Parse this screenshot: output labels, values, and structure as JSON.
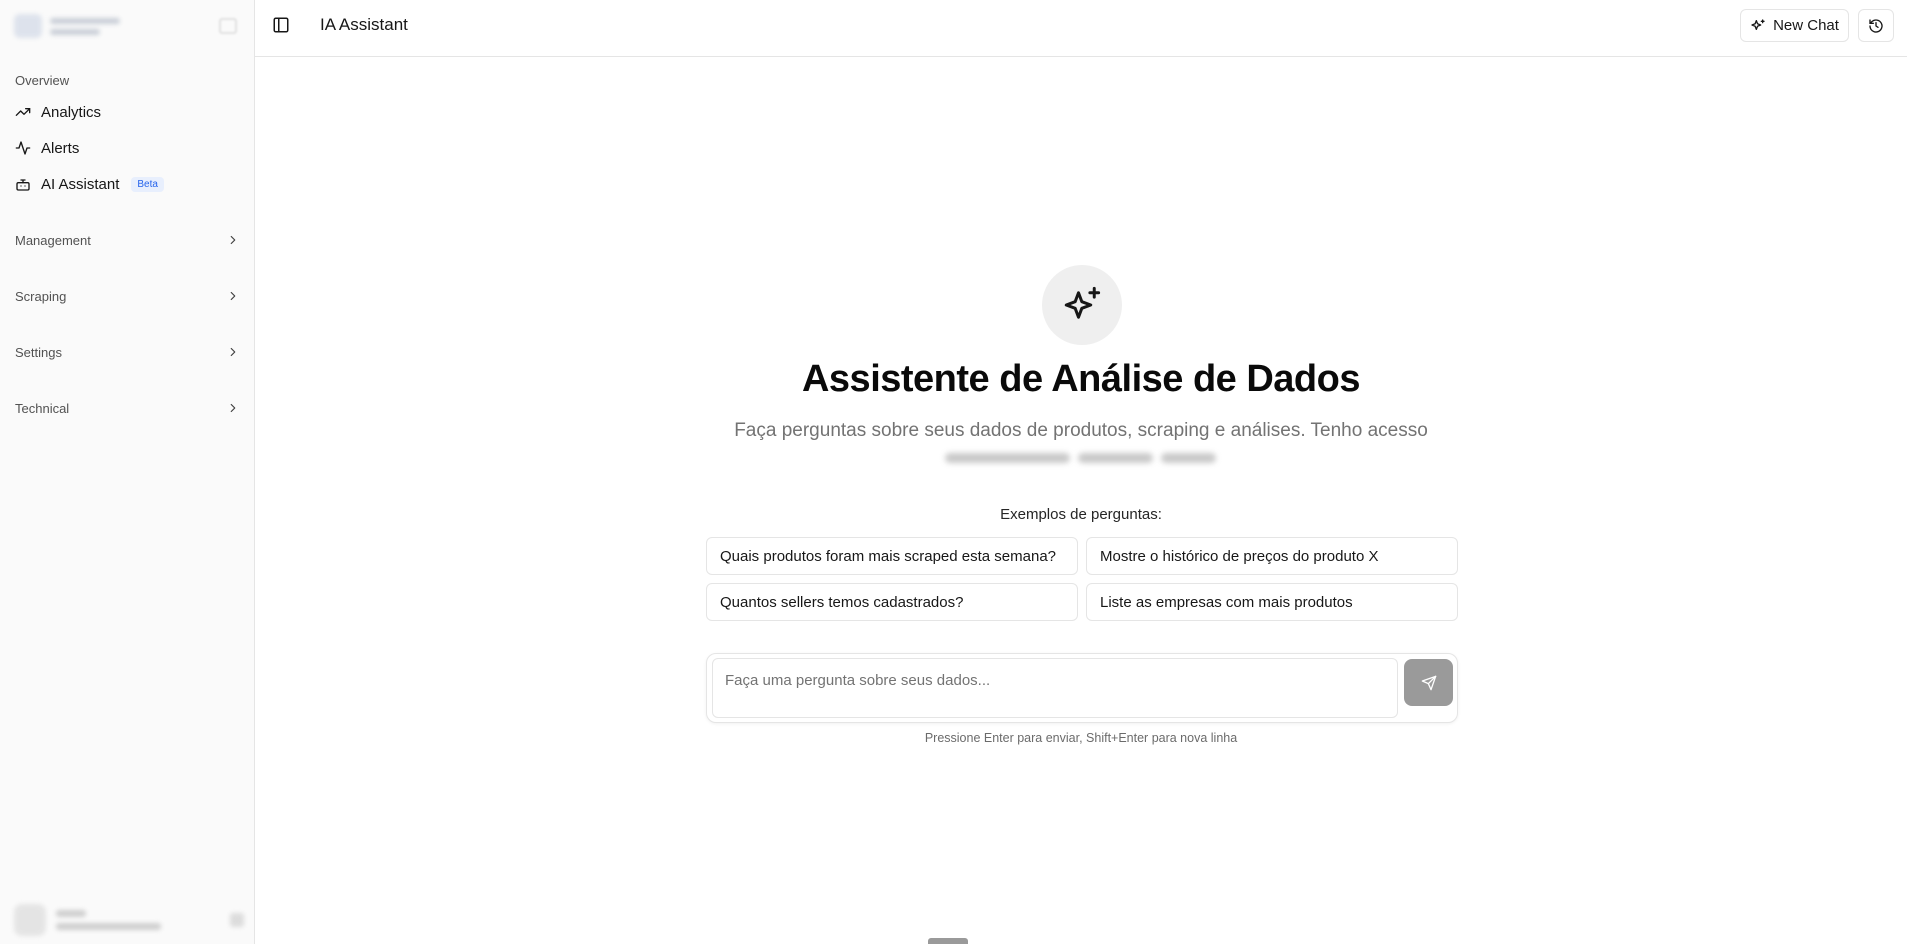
{
  "app": {
    "title": "IA Assistant"
  },
  "sidebar": {
    "overview_label": "Overview",
    "items": [
      {
        "label": "Analytics",
        "icon": "trending-up-icon"
      },
      {
        "label": "Alerts",
        "icon": "activity-icon"
      },
      {
        "label": "AI Assistant",
        "icon": "bot-icon",
        "badge": "Beta"
      }
    ],
    "sections": [
      {
        "label": "Management"
      },
      {
        "label": "Scraping"
      },
      {
        "label": "Settings"
      },
      {
        "label": "Technical"
      }
    ]
  },
  "header": {
    "title": "IA Assistant",
    "new_chat_label": "New Chat"
  },
  "hero": {
    "icon": "sparkles-icon",
    "title": "Assistente de Análise de Dados",
    "subtitle": "Faça perguntas sobre seus dados de produtos, scraping e análises. Tenho acesso"
  },
  "examples": {
    "label": "Exemplos de perguntas:",
    "items": [
      "Quais produtos foram mais scraped esta semana?",
      "Mostre o histórico de preços do produto X",
      "Quantos sellers temos cadastrados?",
      "Liste as empresas com mais produtos"
    ]
  },
  "composer": {
    "placeholder": "Faça uma pergunta sobre seus dados...",
    "value": "",
    "hint": "Pressione Enter para enviar, Shift+Enter para nova linha"
  },
  "colors": {
    "accent_badge": "#2563eb",
    "send_button": "#9a9a9a",
    "border": "#e5e5e5",
    "sidebar_bg": "#fafafa"
  }
}
